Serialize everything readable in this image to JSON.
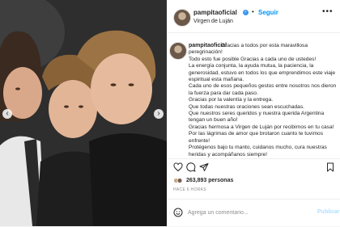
{
  "post": {
    "username": "pampitaoficial",
    "separator": "•",
    "follow_label": "Seguir",
    "location": "Virgen de Luján",
    "more_label": "•••",
    "caption": "Gracias a todos por esta maravillosa peregrinación!\nTodo esto fue posible Gracias a cada uno de ustedes!\nLa energía conjunta, la ayuda mutua, la paciencia, la generosidad, estuvo en todos los que emprendimos este viaje espiritual esta mañana.\nCada uno de esos pequeños gestos entre nosotros nos dieron la fuerza para dar cada paso.\nGracias por la valentía y la entrega.\nQue todas nuestras oraciones sean escuchadas.\nQue nuestros seres queridos y nuestra querida Argentina tengan un buen año!\nGracias hermosa a Virgen de Luján por recibirnos en tu casa! Por las lágrimas de amor que brotaron cuanto te tuvimos enfrente!\nProtégenos bajo tu manto, cuidanos mucho, cura nuestras heridas y acompáñanos siempre!",
    "likes": "263,893 personas",
    "time_ago": "HACE 6 HORAS",
    "comment_placeholder": "Agrega un comentario...",
    "publish_label": "Publicar"
  },
  "icons": [
    "heart-icon",
    "comment-icon",
    "share-icon",
    "bookmark-icon",
    "emoji-icon",
    "verified-icon",
    "chevron-left-icon",
    "chevron-right-icon"
  ],
  "colors": {
    "accent": "#0095f6",
    "verified": "#3897f0",
    "publish_disabled": "#b2dffc",
    "muted": "#8e8e8e"
  }
}
